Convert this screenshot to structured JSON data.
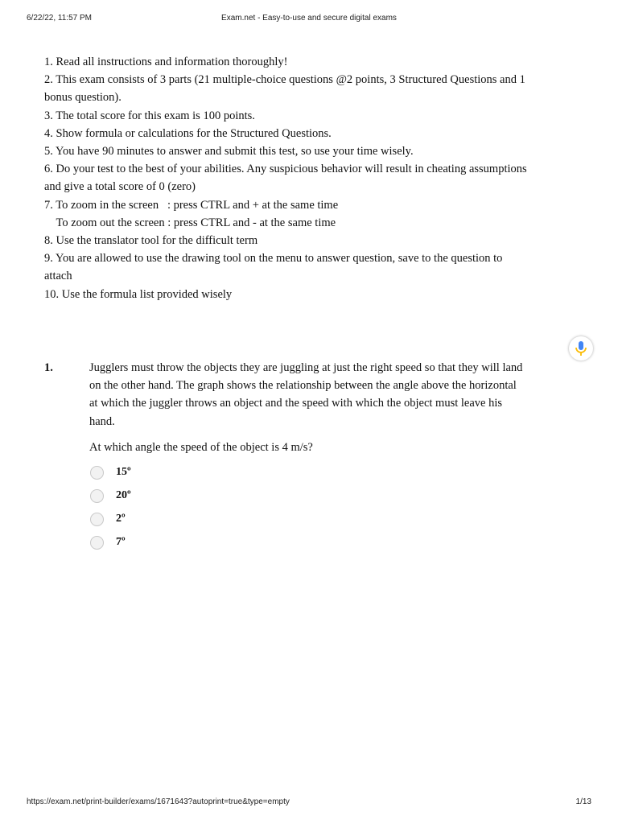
{
  "print_header": {
    "datetime": "6/22/22, 11:57 PM",
    "page_title": "Exam.net - Easy-to-use and secure digital exams"
  },
  "instructions": [
    "1. Read all instructions and information thoroughly!",
    "2. This exam consists of 3 parts (21 multiple-choice questions @2 points, 3 Structured Questions and 1 bonus question).",
    "3. The total score for this exam is 100 points.",
    "4. Show formula or calculations for the Structured Questions.",
    "5. You have 90 minutes to answer and submit this test, so use your time wisely.",
    "6. Do your test to the best of your abilities. Any suspicious behavior will result in cheating assumptions and give a total score of 0 (zero)",
    "7. To zoom in the screen   : press CTRL and + at the same time",
    "    To zoom out the screen : press CTRL and - at the same time",
    "8. Use the translator tool for the difficult term",
    "9. You are allowed to use the drawing tool on the menu to answer question, save to the question to attach",
    "10. Use the formula list provided wisely"
  ],
  "mic_button": {
    "icon": "microphone-icon",
    "colors": {
      "top": "#4285f4",
      "bottom": "#fbbc05"
    }
  },
  "question": {
    "number": "1.",
    "text": "Jugglers must throw the objects they are juggling at just the right speed so that they will land on the other hand. The graph shows the relationship between the angle above the horizontal at which the juggler throws an object and the speed with which the object must leave his hand.",
    "prompt": "At which angle the speed of the object is 4 m/s?",
    "options": [
      "15º",
      "20º",
      "2º",
      "7º"
    ]
  },
  "print_footer": {
    "url": "https://exam.net/print-builder/exams/1671643?autoprint=true&type=empty",
    "page": "1/13"
  }
}
